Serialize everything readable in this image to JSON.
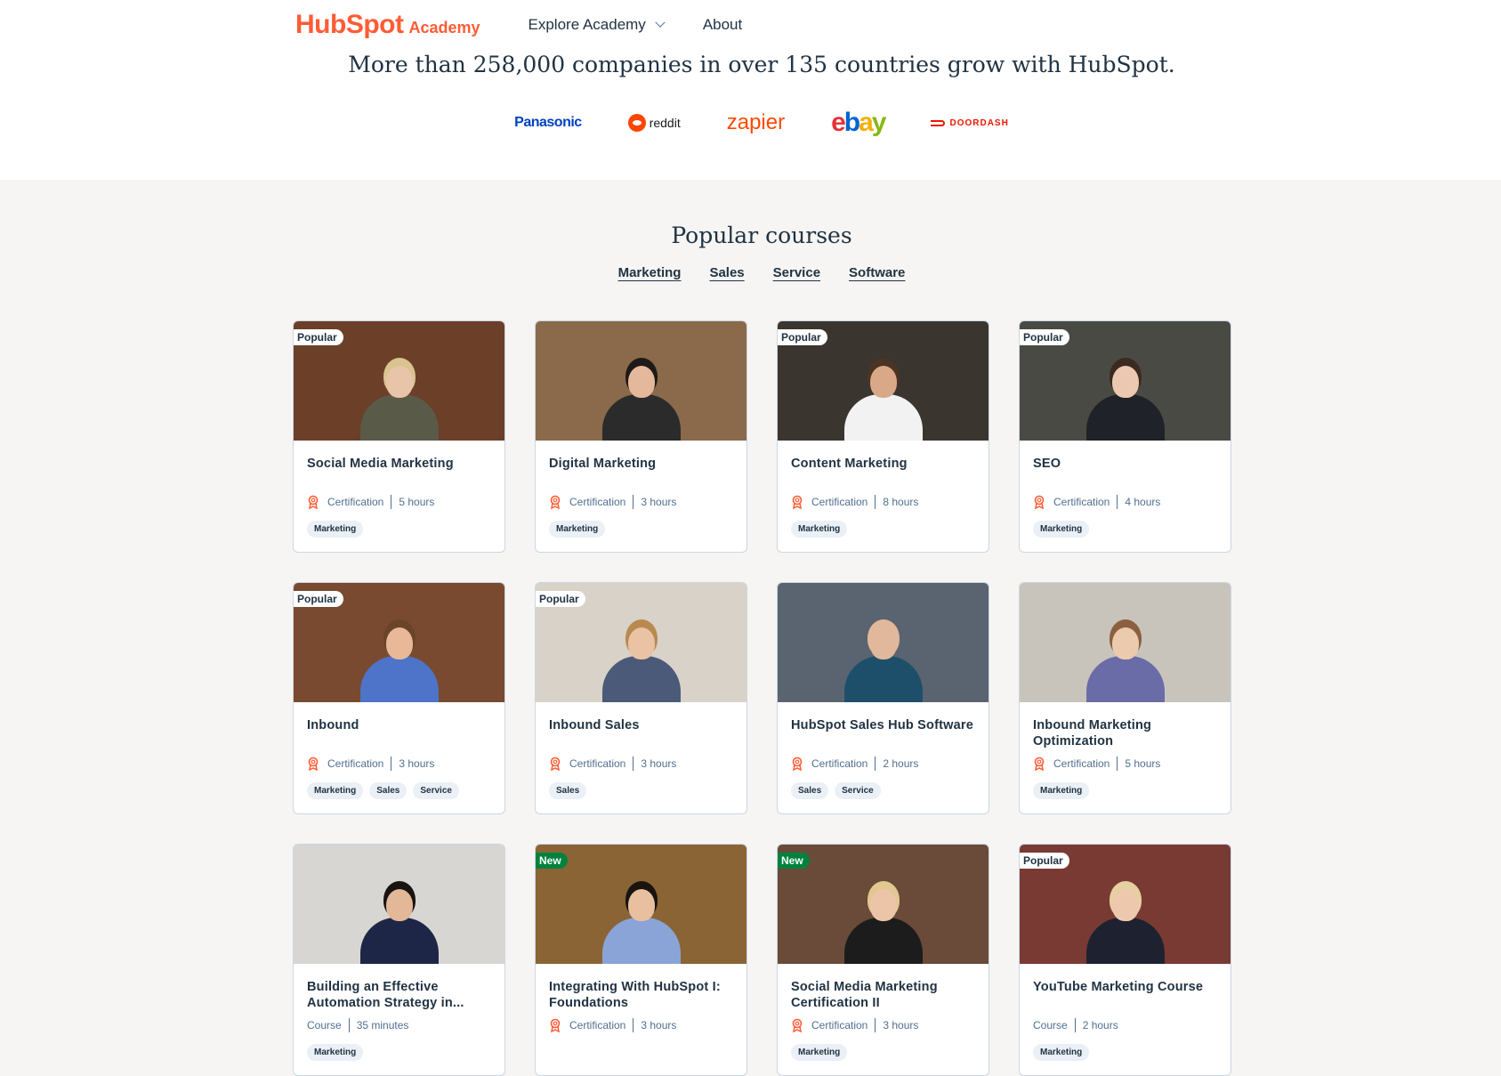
{
  "header": {
    "logo_main": "HubSpot",
    "logo_sub": "Academy",
    "nav": [
      {
        "label": "Explore Academy"
      },
      {
        "label": "About"
      }
    ]
  },
  "tagline": "More than 258,000 companies in over 135 countries grow with HubSpot.",
  "brands": [
    "Panasonic",
    "reddit",
    "zapier",
    "ebay",
    "DOORDASH"
  ],
  "section_title": "Popular courses",
  "filters": [
    "Marketing",
    "Sales",
    "Service",
    "Software"
  ],
  "courses": [
    {
      "title": "Social Media Marketing",
      "badge": "Popular",
      "type": "Certification",
      "duration": "5 hours",
      "tags": [
        "Marketing"
      ],
      "bg": "#6b3f28",
      "shirt": "#5a5a48",
      "skin": "#e8c4a8",
      "hair": "#d9c490"
    },
    {
      "title": "Digital Marketing",
      "badge": "",
      "type": "Certification",
      "duration": "3 hours",
      "tags": [
        "Marketing"
      ],
      "bg": "#8a6a4a",
      "shirt": "#2b2b2b",
      "skin": "#e4b89a",
      "hair": "#1e1a18"
    },
    {
      "title": "Content Marketing",
      "badge": "Popular",
      "type": "Certification",
      "duration": "8 hours",
      "tags": [
        "Marketing"
      ],
      "bg": "#3a352f",
      "shirt": "#f2f2f2",
      "skin": "#d8a888",
      "hair": "#4a3424"
    },
    {
      "title": "SEO",
      "badge": "Popular",
      "type": "Certification",
      "duration": "4 hours",
      "tags": [
        "Marketing"
      ],
      "bg": "#4a4a44",
      "shirt": "#1f2228",
      "skin": "#ecc8b0",
      "hair": "#3a2a20"
    },
    {
      "title": "Inbound",
      "badge": "Popular",
      "type": "Certification",
      "duration": "3 hours",
      "tags": [
        "Marketing",
        "Sales",
        "Service"
      ],
      "bg": "#7a4a30",
      "shirt": "#4d74c8",
      "skin": "#e8b898",
      "hair": "#6a4428"
    },
    {
      "title": "Inbound Sales",
      "badge": "Popular",
      "type": "Certification",
      "duration": "3 hours",
      "tags": [
        "Sales"
      ],
      "bg": "#d8d2c8",
      "shirt": "#4a5a78",
      "skin": "#eac2a4",
      "hair": "#b88a50"
    },
    {
      "title": "HubSpot Sales Hub Software",
      "badge": "",
      "type": "Certification",
      "duration": "2 hours",
      "tags": [
        "Sales",
        "Service"
      ],
      "bg": "#5a6470",
      "shirt": "#1d4f6a",
      "skin": "#e2b89c",
      "hair": "#e2b89c"
    },
    {
      "title": "Inbound Marketing Optimization",
      "badge": "",
      "type": "Certification",
      "duration": "5 hours",
      "tags": [
        "Marketing"
      ],
      "bg": "#c8c4bc",
      "shirt": "#6a6ca8",
      "skin": "#eccaae",
      "hair": "#8a6040"
    },
    {
      "title": "Building an Effective Automation Strategy in...",
      "badge": "",
      "type": "Course",
      "duration": "35 minutes",
      "tags": [
        "Marketing"
      ],
      "bg": "#d8d6d2",
      "shirt": "#1e2648",
      "skin": "#e2b898",
      "hair": "#1a1410"
    },
    {
      "title": "Integrating With HubSpot I: Foundations",
      "badge": "New",
      "type": "Certification",
      "duration": "3 hours",
      "tags": [],
      "bg": "#8a6434",
      "shirt": "#8aa4d8",
      "skin": "#e8c0a0",
      "hair": "#1a1410"
    },
    {
      "title": "Social Media Marketing Certification II",
      "badge": "New",
      "type": "Certification",
      "duration": "3 hours",
      "tags": [
        "Marketing"
      ],
      "bg": "#6a4a38",
      "shirt": "#1c1c1c",
      "skin": "#ecc4a8",
      "hair": "#e0c890"
    },
    {
      "title": "YouTube Marketing Course",
      "badge": "Popular",
      "type": "Course",
      "duration": "2 hours",
      "tags": [
        "Marketing"
      ],
      "bg": "#7a3a34",
      "shirt": "#1e2230",
      "skin": "#eec8ac",
      "hair": "#e4d0a0"
    }
  ],
  "colors": {
    "accent": "#ff5c35",
    "text": "#213343",
    "muted": "#516f90",
    "new_badge": "#00823e"
  }
}
